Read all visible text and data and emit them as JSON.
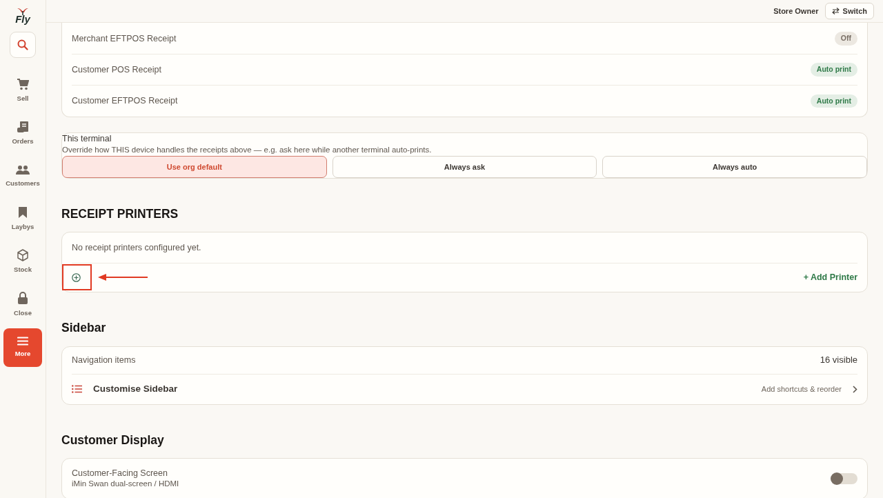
{
  "brand": {
    "logo_text": "Fly"
  },
  "topbar": {
    "user": "Store Owner",
    "switch_button": "Switch"
  },
  "nav": [
    {
      "label": "Sell",
      "selected": false
    },
    {
      "label": "Orders",
      "selected": false
    },
    {
      "label": "Customers",
      "selected": false
    },
    {
      "label": "Laybys",
      "selected": false
    },
    {
      "label": "Stock",
      "selected": false
    },
    {
      "label": "Close",
      "selected": false
    },
    {
      "label": "More",
      "selected": true
    }
  ],
  "receipts": [
    {
      "label": "Merchant EFTPOS Receipt",
      "status": "Off",
      "kind": "off"
    },
    {
      "label": "Customer POS Receipt",
      "status": "Auto print",
      "kind": "auto"
    },
    {
      "label": "Customer EFTPOS Receipt",
      "status": "Auto print",
      "kind": "auto"
    }
  ],
  "terminal": {
    "title": "This terminal",
    "description": "Override how THIS device handles the receipts above — e.g. ask here while another terminal auto-prints.",
    "options": [
      {
        "label": "Use org default",
        "selected": true
      },
      {
        "label": "Always ask",
        "selected": false
      },
      {
        "label": "Always auto",
        "selected": false
      }
    ]
  },
  "receipt_printers": {
    "heading": "RECEIPT PRINTERS",
    "empty_text": "No receipt printers configured yet.",
    "add_button": "+ Add Printer"
  },
  "sidebar_section": {
    "heading": "Sidebar",
    "nav_label": "Navigation items",
    "nav_count": "16 visible",
    "customise_label": "Customise Sidebar",
    "customise_hint": "Add shortcuts & reorder"
  },
  "customer_display": {
    "heading": "Customer Display",
    "title": "Customer-Facing Screen",
    "subtitle": "iMin Swan dual-screen / HDMI",
    "on": false
  }
}
